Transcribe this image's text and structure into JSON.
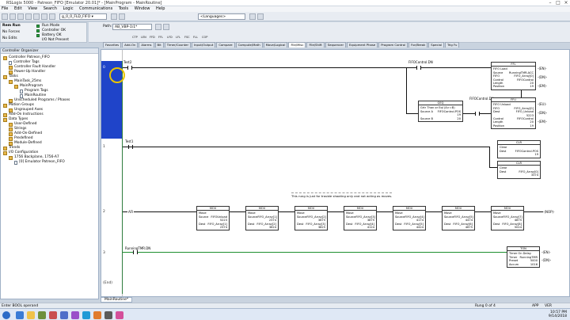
{
  "window": {
    "title": "RSLogix 5000 - Patreon_FIFO [Emulator 20.01]* - [MainProgram - MainRoutine]",
    "controls": [
      "–",
      "□",
      "×"
    ]
  },
  "menu": [
    "File",
    "Edit",
    "View",
    "Search",
    "Logic",
    "Communications",
    "Tools",
    "Window",
    "Help"
  ],
  "toolbar": {
    "path_value": "AB_VBP-1\\1*",
    "search_placeholder": "<Languages>"
  },
  "status_panel": {
    "mode": "Rem Run",
    "no_forces": "No Forces",
    "no_edits": "No Edits",
    "run_mode": "Run Mode",
    "controller_ok": "Controller OK",
    "battery_ok": "Battery OK",
    "io_not_present": "I/O Not Present",
    "path": "Path: AB_VBP-1\\1*"
  },
  "instruction_toolbar": [
    "CTP",
    "LEN",
    "FFD",
    "FFL",
    "LFD",
    "LFL",
    "FSC",
    "FLL",
    "COP",
    "CPS",
    "DDT",
    "SRT",
    "STD",
    "AVE",
    "SIZE",
    "RES"
  ],
  "category_tabs": [
    "Favorites",
    "Add-On",
    "Alarms",
    "Bit",
    "Timer/Counter",
    "Input/Output",
    "Compare",
    "Compute/Math",
    "Move/Logical",
    "File/Misc",
    "File/Shift",
    "Sequencer",
    "Equipment Phase",
    "Program Control",
    "For/Break",
    "Special",
    "Trig Fu"
  ],
  "organizer": {
    "header": "Controller Organizer",
    "items": [
      {
        "label": "Controller Patreon_FIFO",
        "level": 0,
        "icon": "folder-icon"
      },
      {
        "label": "Controller Tags",
        "level": 1,
        "icon": "doc-icon"
      },
      {
        "label": "Controller Fault Handler",
        "level": 1,
        "icon": "folder-icon"
      },
      {
        "label": "Power-Up Handler",
        "level": 1,
        "icon": "folder-icon"
      },
      {
        "label": "Tasks",
        "level": 0,
        "icon": "folder-icon"
      },
      {
        "label": "MainTask_25ms",
        "level": 1,
        "icon": "folder-icon"
      },
      {
        "label": "MainProgram",
        "level": 2,
        "icon": "folder-icon"
      },
      {
        "label": "Program Tags",
        "level": 3,
        "icon": "doc-icon"
      },
      {
        "label": "MainRoutine",
        "level": 3,
        "icon": "doc-icon"
      },
      {
        "label": "Unscheduled Programs / Phases",
        "level": 1,
        "icon": "folder-icon"
      },
      {
        "label": "Motion Groups",
        "level": 0,
        "icon": "folder-icon"
      },
      {
        "label": "Ungrouped Axes",
        "level": 1,
        "icon": "folder-icon"
      },
      {
        "label": "Add-On Instructions",
        "level": 0,
        "icon": "folder-icon"
      },
      {
        "label": "Data Types",
        "level": 0,
        "icon": "folder-icon"
      },
      {
        "label": "User-Defined",
        "level": 1,
        "icon": "folder-icon"
      },
      {
        "label": "Strings",
        "level": 1,
        "icon": "folder-icon"
      },
      {
        "label": "Add-On-Defined",
        "level": 1,
        "icon": "folder-icon"
      },
      {
        "label": "Predefined",
        "level": 1,
        "icon": "folder-icon"
      },
      {
        "label": "Module-Defined",
        "level": 1,
        "icon": "folder-icon"
      },
      {
        "label": "Trends",
        "level": 0,
        "icon": "folder-icon"
      },
      {
        "label": "I/O Configuration",
        "level": 0,
        "icon": "folder-icon"
      },
      {
        "label": "1756 Backplane, 1756-A7",
        "level": 1,
        "icon": "folder-icon"
      },
      {
        "label": "[0] Emulator Patreon_FIFO",
        "level": 2,
        "icon": "doc-icon"
      }
    ]
  },
  "ladder": {
    "rung0": {
      "num": "0",
      "xic_tag": "Test2",
      "xio_tag": "FIFOControl.DN",
      "ffl": {
        "title": "FFL",
        "rows": [
          [
            "FIFO Load",
            ""
          ],
          [
            "Source",
            "RunningTMR.ACC"
          ],
          [
            "FIFO",
            "FIFO_Array[0]"
          ],
          [
            "Control",
            "FIFOControl"
          ],
          [
            "Length",
            "20"
          ],
          [
            "Position",
            "19"
          ]
        ],
        "coils": [
          "-(EN)-",
          "-(DN)-",
          "-(EM)-"
        ]
      },
      "geq": {
        "title": "GEQ",
        "rows": [
          [
            "Grtr Than or Eql (A>=B)",
            ""
          ],
          [
            "Source A",
            "FIFOControl.POS"
          ],
          [
            "",
            "19"
          ],
          [
            "Source B",
            "20"
          ]
        ]
      },
      "xic2_tag": "FIFOControl.DN",
      "ffu": {
        "title": "FFU",
        "rows": [
          [
            "FIFO Unload",
            ""
          ],
          [
            "FIFO",
            "FIFO_Array[0]"
          ],
          [
            "Dest",
            "FIFO_Unload"
          ],
          [
            "",
            "5223"
          ],
          [
            "Control",
            "FIFOControl"
          ],
          [
            "Length",
            "20"
          ],
          [
            "Position",
            "19"
          ]
        ],
        "coils": [
          "-(EU)-",
          "-(DN)-",
          "-(EM)-"
        ]
      }
    },
    "rung1": {
      "num": "1",
      "xic_tag": "Test1",
      "clr1": {
        "title": "CLR",
        "rows": [
          [
            "Clear",
            ""
          ],
          [
            "Dest",
            "FIFOControl.POS"
          ],
          [
            "",
            "19"
          ]
        ]
      },
      "clr2": {
        "title": "CLR",
        "rows": [
          [
            "Clear",
            ""
          ],
          [
            "Dest",
            "FIFO_Array[0]"
          ],
          [
            "",
            "3374"
          ]
        ]
      }
    },
    "rung2": {
      "num": "2",
      "comment": "This rung is just for trouble shooting only and not acting as moves.",
      "afi": "AFI",
      "movs": [
        {
          "src": "FIFOUnload",
          "srcv": "5223",
          "dest": "FIFO_Array[1]",
          "destv": "2374"
        },
        {
          "src": "FIFO_Array[1]",
          "srcv": "2374",
          "dest": "FIFO_Array[2]",
          "destv": "3624"
        },
        {
          "src": "FIFO_Array[2]",
          "srcv": "3675",
          "dest": "FIFO_Array[3]",
          "destv": "3825"
        },
        {
          "src": "FIFO_Array[3]",
          "srcv": "3875",
          "dest": "FIFO_Array[4]",
          "destv": "4124"
        },
        {
          "src": "FIFO_Array[4]",
          "srcv": "4174",
          "dest": "FIFO_Array[5]",
          "destv": "4424"
        },
        {
          "src": "FIFO_Array[5]",
          "srcv": "4474",
          "dest": "FIFO_Array[6]",
          "destv": "4675"
        },
        {
          "src": "FIFO_Array[7]",
          "srcv": "4875",
          "dest": "FIFO_Array[8]",
          "destv": "5024"
        }
      ],
      "nop": "-(NOP)-"
    },
    "rung3": {
      "num": "3",
      "xio_tag": "RunningTMR.DN",
      "ton": {
        "title": "TON",
        "rows": [
          [
            "Timer On Delay",
            ""
          ],
          [
            "Timer",
            "RunningTMR"
          ],
          [
            "Preset",
            "5000"
          ],
          [
            "Accum",
            "1016"
          ]
        ],
        "coils": [
          "-(EN)-",
          "-(DN)-"
        ]
      }
    },
    "end": "(End)"
  },
  "bottom_tab": "MainRoutine*",
  "statusbar": {
    "left": "Enter BOOL operand",
    "right": "Rung 0 of 4",
    "app": "APP",
    "ver": "VER"
  },
  "clock": {
    "time": "10:57 PM",
    "date": "9/14/2018"
  }
}
